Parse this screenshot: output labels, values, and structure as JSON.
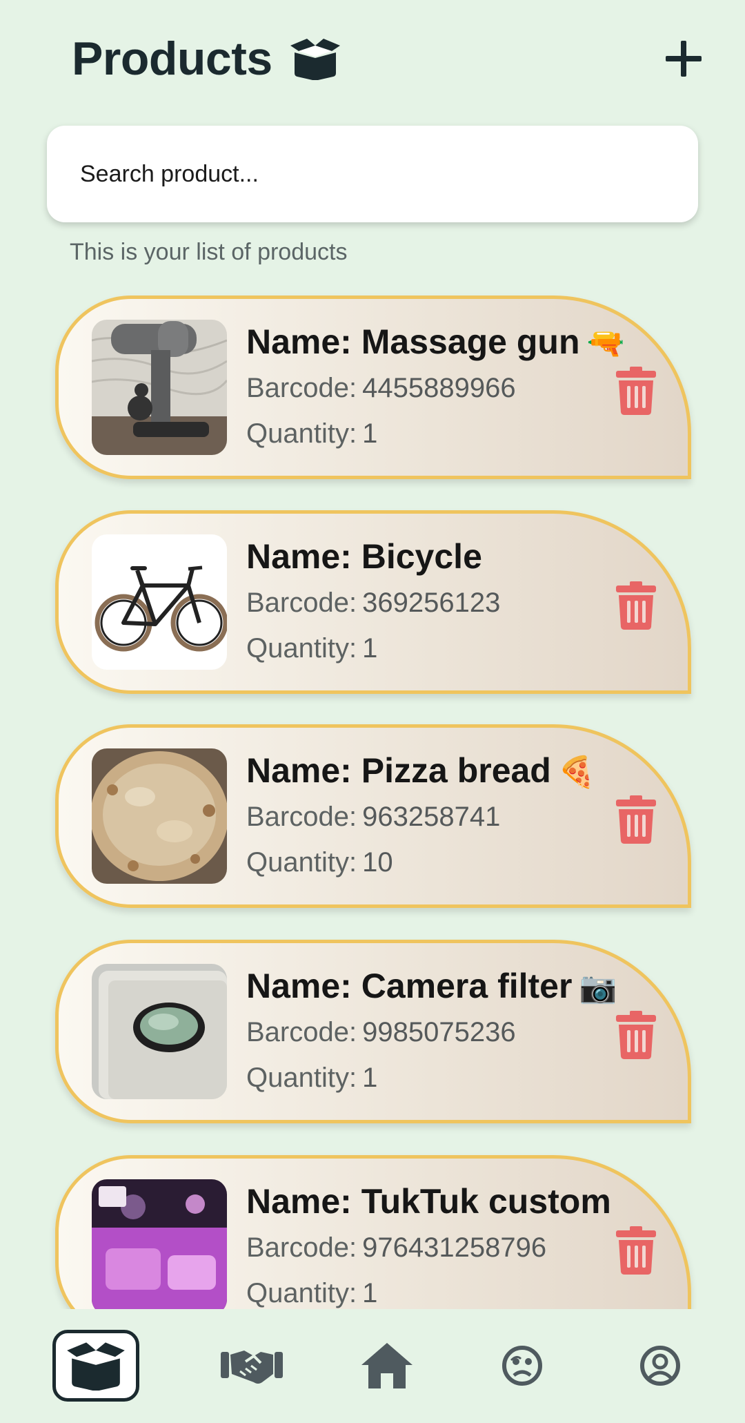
{
  "header": {
    "title": "Products",
    "title_icon": "open-box-icon",
    "add_icon": "plus-icon"
  },
  "search": {
    "placeholder": "Search product..."
  },
  "subtitle": "This is your list of products",
  "labels": {
    "name": "Name:",
    "barcode": "Barcode:",
    "quantity": "Quantity:"
  },
  "products": [
    {
      "name": "Massage gun",
      "emoji": "🔫",
      "barcode": "4455889966",
      "quantity": "1",
      "image": "massage-gun-photo"
    },
    {
      "name": "Bicycle",
      "emoji": "",
      "barcode": "369256123",
      "quantity": "1",
      "image": "bicycle-photo"
    },
    {
      "name": "Pizza bread",
      "emoji": "🍕",
      "barcode": "963258741",
      "quantity": "10",
      "image": "pizza-bread-photo"
    },
    {
      "name": "Camera filter",
      "emoji": "📷",
      "barcode": "9985075236",
      "quantity": "1",
      "image": "camera-filter-photo"
    },
    {
      "name": "TukTuk custom",
      "emoji": "",
      "barcode": "976431258796",
      "quantity": "1",
      "image": "tuktuk-photo"
    }
  ],
  "nav": [
    {
      "icon": "products-box-icon",
      "active": true
    },
    {
      "icon": "handshake-icon",
      "active": false
    },
    {
      "icon": "home-icon",
      "active": false
    },
    {
      "icon": "face-icon",
      "active": false
    },
    {
      "icon": "account-circle-icon",
      "active": false
    }
  ],
  "colors": {
    "background": "#e5f3e6",
    "card_border": "#efc45e",
    "trash": "#e86565",
    "text_dark": "#1b2a2f"
  }
}
